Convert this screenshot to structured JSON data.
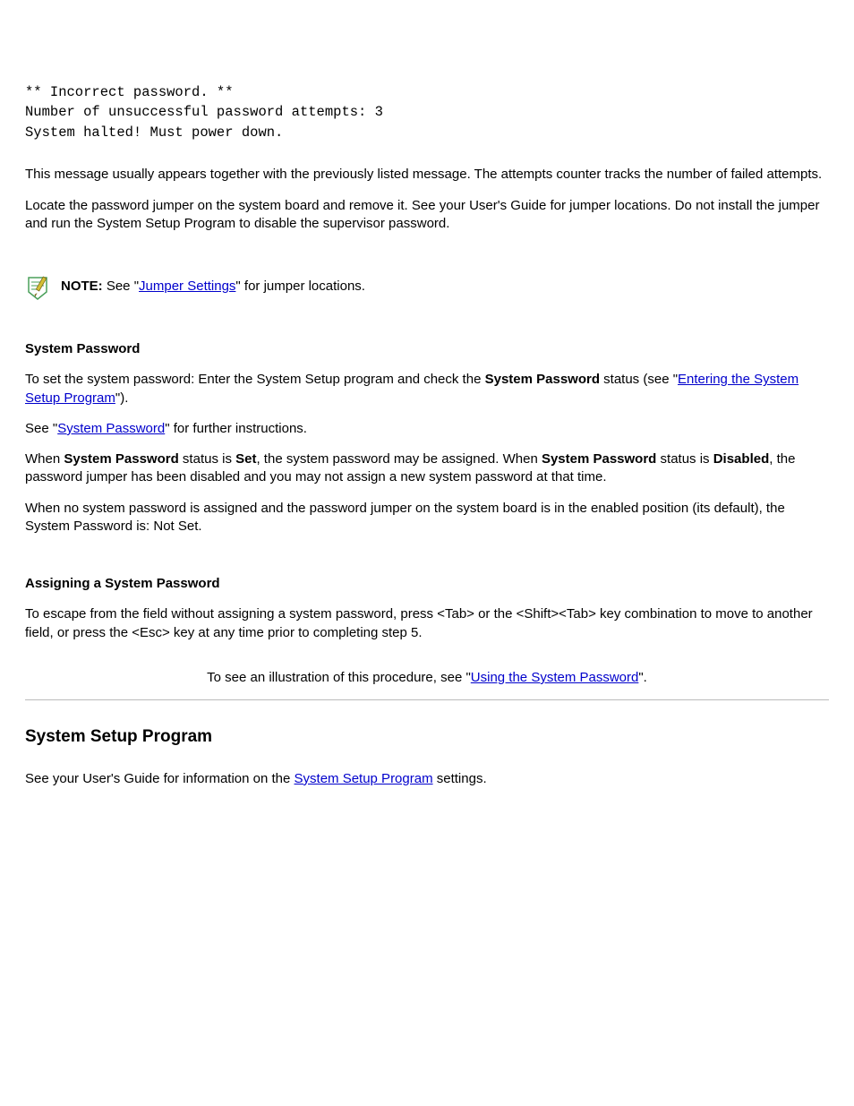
{
  "console": {
    "line1": "** Incorrect password. **",
    "line2": "Number of unsuccessful password attempts: 3",
    "line3": "System halted! Must power down."
  },
  "para1": "This message usually appears together with the previously listed message. The attempts counter tracks the number of failed attempts.",
  "para2": "Locate the password jumper on the system board and remove it. See your User's Guide for jumper locations. Do not install the jumper and run the System Setup Program to disable the supervisor password.",
  "note": {
    "bold": "NOTE:",
    "text_before_link": " See \"",
    "link": "Jumper Settings",
    "text_after_link": "\" for jumper locations."
  },
  "heading1": "System Password",
  "para3_before1": "To set the system password: Enter the System Setup program and check the ",
  "para3_bold1": "System Password",
  "para3_after1": " status (see \"",
  "para3_link1": "Entering the System Setup Program",
  "para3_after2": "\").",
  "para4_before": "See \"",
  "para4_link": "System Password",
  "para4_after": "\" for further instructions.",
  "para5_prefix": "When ",
  "para5_bold1": "System Password",
  "para5_mid1": " status is ",
  "para5_bold2": "Set",
  "para5_mid2": ", the system password may be assigned. When ",
  "para5_bold3": "System Password",
  "para5_mid3": " status is ",
  "para5_bold4": "Disabled",
  "para5_end": ", the password jumper has been disabled and you may not assign a new system password at that time.",
  "para6": "When no system password is assigned and the password jumper on the system board is in the enabled position (its default), the System Password is: Not  Set.",
  "heading2": "Assigning a System Password",
  "para7": "To escape from the field without assigning a system password, press <Tab> or the <Shift><Tab> key combination to move to another field, or press the <Esc> key at any time prior to completing step 5.",
  "center_text_before": "To see an illustration of this procedure, see \"",
  "center_link": "Using the System Password",
  "center_text_after": "\".",
  "heading3": "System Setup Program",
  "last_para_before": "See your User's Guide for information on the ",
  "last_link": "System Setup Program",
  "last_para_after": " settings."
}
